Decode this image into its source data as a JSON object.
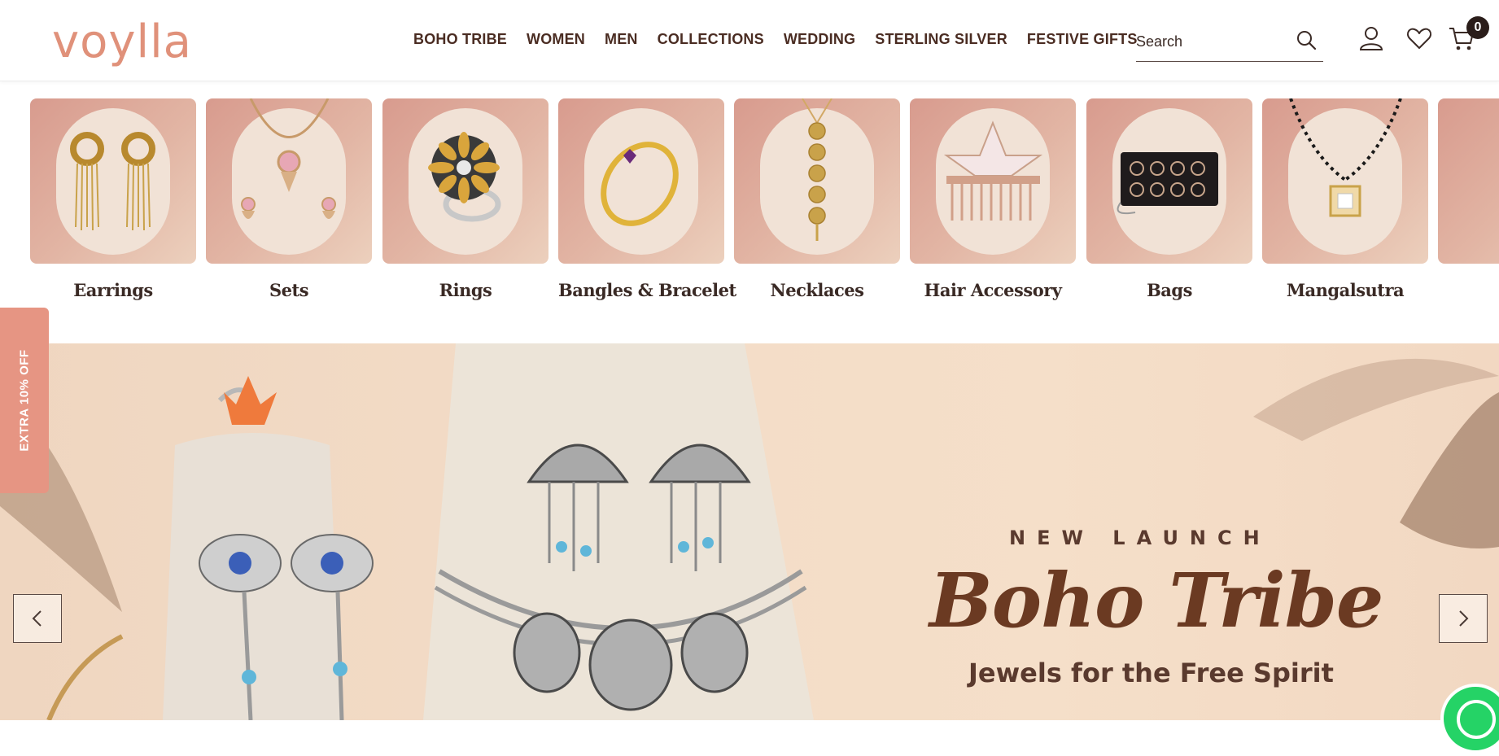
{
  "brand": {
    "logo_text": "voylla"
  },
  "nav": {
    "items": [
      {
        "label": "BOHO TRIBE"
      },
      {
        "label": "WOMEN"
      },
      {
        "label": "MEN"
      },
      {
        "label": "COLLECTIONS"
      },
      {
        "label": "WEDDING"
      },
      {
        "label": "STERLING SILVER"
      },
      {
        "label": "FESTIVE GIFTS"
      }
    ]
  },
  "search": {
    "placeholder": "Search",
    "value": "",
    "icon": "search-icon"
  },
  "header_icons": {
    "account": "user-icon",
    "wishlist": "heart-icon",
    "cart": "cart-icon",
    "cart_count": "0"
  },
  "categories": [
    {
      "label": "Earrings",
      "icon": "earrings-image"
    },
    {
      "label": "Sets",
      "icon": "jewellery-set-image"
    },
    {
      "label": "Rings",
      "icon": "ring-image"
    },
    {
      "label": "Bangles & Bracelet",
      "icon": "bangle-image"
    },
    {
      "label": "Necklaces",
      "icon": "necklace-image"
    },
    {
      "label": "Hair Accessory",
      "icon": "hair-comb-image"
    },
    {
      "label": "Bags",
      "icon": "clutch-bag-image"
    },
    {
      "label": "Mangalsutra",
      "icon": "mangalsutra-image"
    }
  ],
  "side_tab": {
    "label": "EXTRA 10% OFF"
  },
  "banner": {
    "kicker": "NEW LAUNCH",
    "title": "Boho Tribe",
    "subtitle": "Jewels for the Free Spirit"
  },
  "colors": {
    "accent": "#e69583",
    "logo": "#e0917a",
    "text_dark": "#4a2c22",
    "banner_title": "#6b3a22"
  }
}
